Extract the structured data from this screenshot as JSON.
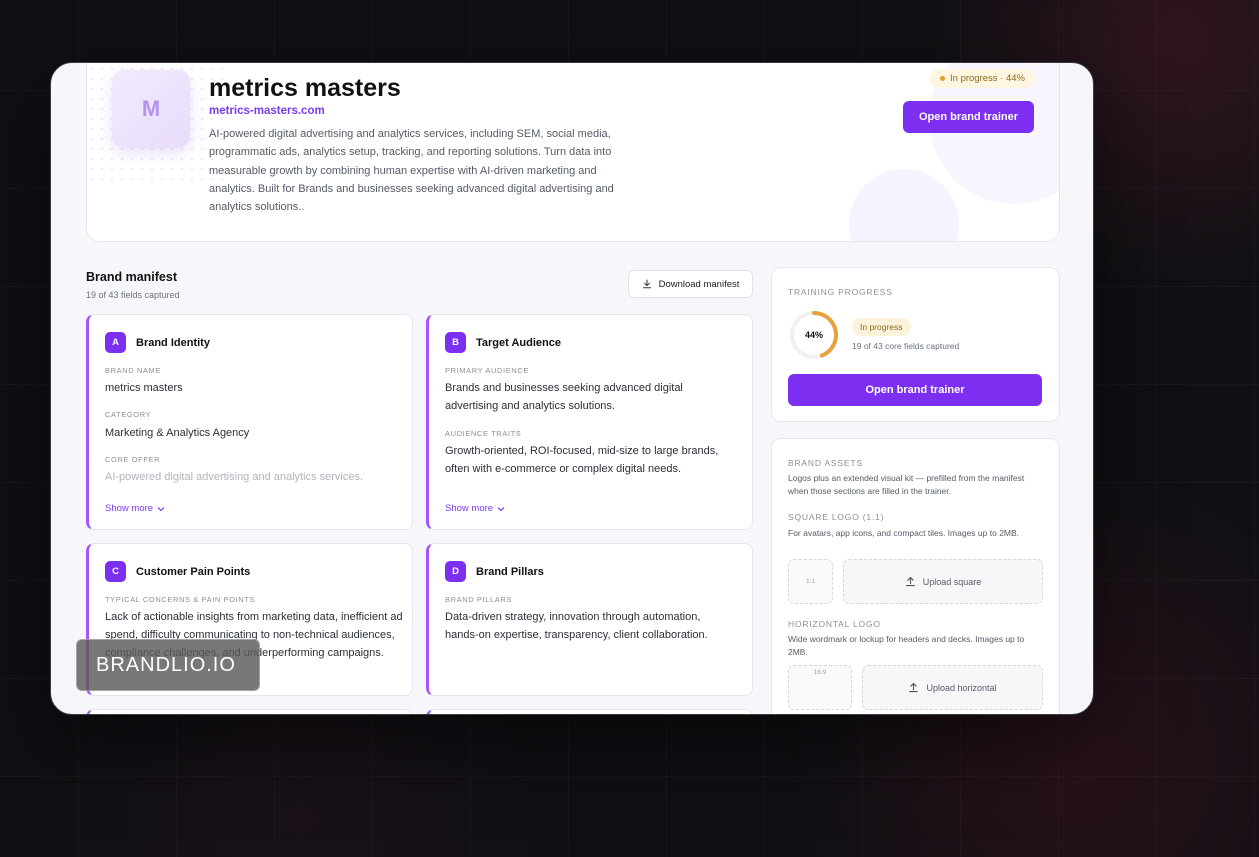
{
  "hero": {
    "logo_letter": "M",
    "title": "metrics masters",
    "url": "metrics-masters.com",
    "description": "AI-powered digital advertising and analytics services, including SEM, social media, programmatic ads, analytics setup, tracking, and reporting solutions. Turn data into measurable growth by combining human expertise with AI-driven marketing and analytics. Built for Brands and businesses seeking advanced digital advertising and analytics solutions..",
    "status": "In progress · 44%",
    "trainer_button": "Open brand trainer"
  },
  "manifest": {
    "title": "Brand manifest",
    "subtitle": "19 of 43 fields captured",
    "download_label": "Download manifest",
    "cards": [
      {
        "letter": "A",
        "title": "Brand Identity",
        "fields": [
          {
            "label": "BRAND NAME",
            "value": "metrics masters"
          },
          {
            "label": "CATEGORY",
            "value": "Marketing & Analytics Agency"
          },
          {
            "label": "CORE OFFER",
            "value": "AI-powered digital advertising and analytics services."
          }
        ],
        "show_more": "Show more"
      },
      {
        "letter": "B",
        "title": "Target Audience",
        "fields": [
          {
            "label": "PRIMARY AUDIENCE",
            "value": "Brands and businesses seeking advanced digital advertising and analytics solutions."
          },
          {
            "label": "AUDIENCE TRAITS",
            "value": "Growth-oriented, ROI-focused, mid-size to large brands, often with e-commerce or complex digital needs."
          }
        ],
        "show_more": "Show more"
      },
      {
        "letter": "C",
        "title": "Customer Pain Points",
        "fields": [
          {
            "label": "TYPICAL CONCERNS & PAIN POINTS",
            "value": "Lack of actionable insights from marketing data, inefficient ad spend, difficulty communicating to non-technical audiences, compliance challenges, and underperforming campaigns."
          }
        ]
      },
      {
        "letter": "D",
        "title": "Brand Pillars",
        "fields": [
          {
            "label": "BRAND PILLARS",
            "value": "Data-driven strategy, innovation through automation, hands-on expertise, transparency, client collaboration."
          }
        ]
      }
    ]
  },
  "training": {
    "label": "TRAINING PROGRESS",
    "percent": 44,
    "percent_label": "44%",
    "status": "In progress",
    "fields_text": "19 of 43 core fields captured",
    "button": "Open brand trainer"
  },
  "assets": {
    "label": "BRAND ASSETS",
    "description": "Logos plus an extended visual kit — prefilled from the manifest when those sections are filled in the trainer.",
    "square": {
      "label": "SQUARE LOGO (1:1)",
      "description": "For avatars, app icons, and compact tiles. Images up to 2MB.",
      "ratio": "1:1",
      "upload": "Upload square"
    },
    "horizontal": {
      "label": "HORIZONTAL LOGO",
      "description": "Wide wordmark or lockup for headers and decks. Images up to 2MB.",
      "ratio": "16:9",
      "upload": "Upload horizontal"
    }
  },
  "watermark": "BRANDLIO.IO",
  "colors": {
    "accent": "#7c2ff0",
    "progress": "#e8a23a",
    "card_border": "#a855f7"
  }
}
